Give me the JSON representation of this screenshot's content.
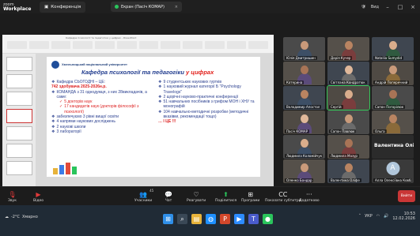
{
  "app": {
    "brand_top": "zoom",
    "brand_name": "Workplace",
    "conference_tab": "Конференція",
    "screen_tab": "Екран (Пасіч КОМАР)",
    "right_status": "Вид"
  },
  "ppt": {
    "window_title": "Кафедра психології та педагогіки у цифрах - PowerPoint"
  },
  "slide": {
    "university": "Хмельницький національний університет",
    "title_main": "Кафедра психології та педагогіки",
    "title_accent": "у цифрах",
    "left": [
      {
        "text": "Кафедра СЬОГОДНІ – ЦЕ:",
        "kind": "bullet"
      },
      {
        "text": "742 здобувача 2025-2026н.р.",
        "kind": "red"
      },
      {
        "text": "КОМАНДА з 31 однодумця, з них 28викладачів, а саме:",
        "kind": "bullet"
      },
      {
        "text": "5 докторів наук",
        "kind": "sub"
      },
      {
        "text": "17 кандидатів наук (докторів філософії з психології)",
        "kind": "sub"
      },
      {
        "text": "забезпечуємо 3 рівні вищої освіти",
        "kind": "bullet"
      },
      {
        "text": "4 напрями наукових досліджень",
        "kind": "bullet"
      },
      {
        "text": "2 наукові школи",
        "kind": "bullet"
      },
      {
        "text": "3 лабораторії",
        "kind": "bullet"
      }
    ],
    "right": [
      {
        "text": "9 студентських наукових гуртків",
        "kind": "bullet"
      },
      {
        "text": "1 науковий журнал категорії Б \"Psychology Travelogs\"",
        "kind": "bullet"
      },
      {
        "text": "2 щорічні науково-практичні конференції",
        "kind": "bullet"
      },
      {
        "text": "51 навчальних посібників з грифом МОН і ХНУ та монографій",
        "kind": "bullet"
      },
      {
        "text": "104 навчально-методичні розробки (методичні вказівки, рекомендації тощо)",
        "kind": "bullet"
      },
      {
        "text": "… І ЦЕ !!!",
        "kind": "cheer"
      }
    ]
  },
  "participants": [
    "Юлія Дмитришин",
    "Дарія Кучер",
    "Nataliia Sumydid",
    "Катерина",
    "Світлана Кондратюк",
    "Андрій Поперечний",
    "Володимир Апостол",
    "Сергій",
    "Сапон Погорілюк",
    "Пасіч КОМАР",
    "Сапон Павлюк",
    "Ольга",
    "Людмила Коломійчук",
    "Людмила Мазур",
    "Оленко Бондар",
    "Валентина Оліфе",
    "Андрій Матвієнко",
    "Павло Мигульський",
    "Валентина Олійник",
    "Наталія",
    "Віталій Сапон",
    "Віталій",
    "Алла Олексіївна Ковбан"
  ],
  "named_tile": "Валентина Олі...",
  "avatar_letter": "A",
  "toolbar": {
    "audio": "Звук",
    "video": "Відео",
    "participants": "Учасники",
    "participants_count": "45",
    "chat": "Чат",
    "react": "Реагувати",
    "share": "Поділитися",
    "apps": "Програми",
    "captions": "Показати субтитри",
    "more": "Додатково",
    "leave": "Вийти"
  },
  "taskbar": {
    "temperature": "-2°C",
    "weather": "Хмарно",
    "language": "УКР",
    "time": "10:53",
    "date": "12.02.2026"
  },
  "colors": {
    "speaking": "#35c759",
    "slide_title": "#223d8f",
    "slide_red": "#e2211c"
  }
}
